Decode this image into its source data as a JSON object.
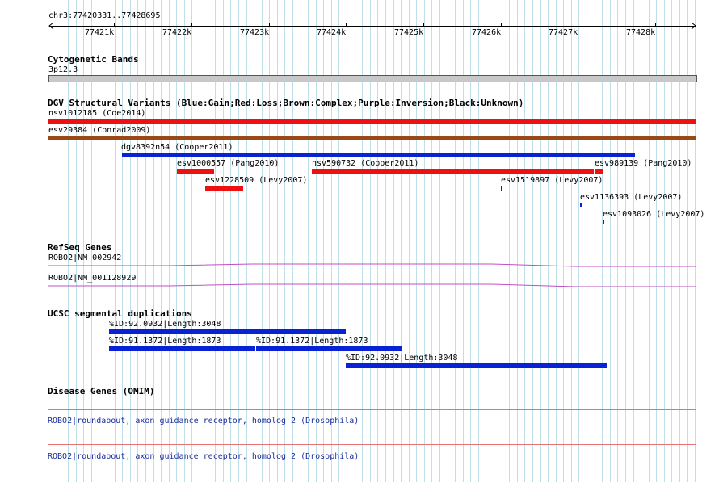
{
  "ruler": {
    "range_label": "chr3:77420331..77428695",
    "ticks": [
      "77421k",
      "77422k",
      "77423k",
      "77424k",
      "77425k",
      "77426k",
      "77427k",
      "77428k"
    ]
  },
  "cytoband": {
    "title": "Cytogenetic Bands",
    "band": "3p12.3"
  },
  "dgv": {
    "title": "DGV Structural Variants (Blue:Gain;Red:Loss;Brown:Complex;Purple:Inversion;Black:Unknown)",
    "items": [
      {
        "label": "nsv1012185 (Coe2014)",
        "type": "loss"
      },
      {
        "label": "esv29384 (Conrad2009)",
        "type": "complex"
      },
      {
        "label": "dgv8392n54 (Cooper2011)",
        "type": "gain"
      },
      {
        "label": "esv1000557 (Pang2010)",
        "type": "loss"
      },
      {
        "label": "nsv590732 (Cooper2011)",
        "type": "loss"
      },
      {
        "label": "esv989139 (Pang2010)",
        "type": "loss"
      },
      {
        "label": "esv1228509 (Levy2007)",
        "type": "loss"
      },
      {
        "label": "esv1519897 (Levy2007)",
        "type": "gain"
      },
      {
        "label": "esv1136393 (Levy2007)",
        "type": "gain"
      },
      {
        "label": "esv1093026 (Levy2007)",
        "type": "gain"
      }
    ]
  },
  "refseq": {
    "title": "RefSeq Genes",
    "genes": [
      "ROBO2|NM_002942",
      "ROBO2|NM_001128929"
    ]
  },
  "segdup": {
    "title": "UCSC segmental duplications",
    "items": [
      "%ID:92.0932|Length:3048",
      "%ID:91.1372|Length:1873",
      "%ID:91.1372|Length:1873",
      "%ID:92.0932|Length:3048"
    ]
  },
  "omim": {
    "title": "Disease Genes (OMIM)",
    "items": [
      "ROBO2|roundabout, axon guidance receptor, homolog 2 (Drosophila)",
      "ROBO2|roundabout, axon guidance receptor, homolog 2 (Drosophila)"
    ]
  },
  "colors": {
    "gain": "#0a22d6",
    "loss": "#ee1111",
    "complex": "#9a4a14",
    "gene_line": "#c050c0",
    "omim_line": "#e87070",
    "grid": "#bfe0ea",
    "band": "#c8c8c8"
  }
}
